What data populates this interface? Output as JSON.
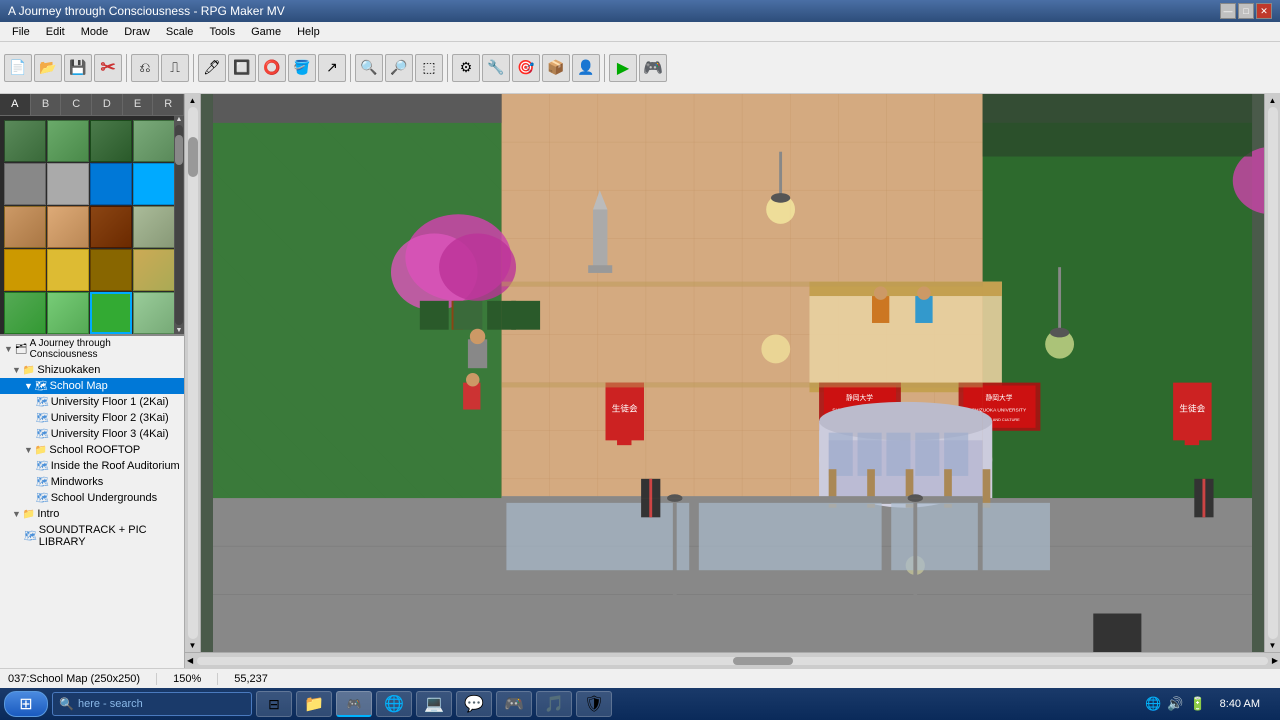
{
  "titlebar": {
    "title": "A Journey through Consciousness - RPG Maker MV",
    "controls": [
      "—",
      "□",
      "✕"
    ]
  },
  "menubar": {
    "items": [
      "File",
      "Edit",
      "Mode",
      "Draw",
      "Scale",
      "Tools",
      "Game",
      "Help"
    ]
  },
  "toolbar": {
    "groups": [
      [
        "💾",
        "📂",
        "🖫",
        "⎌",
        "⎍"
      ],
      [
        "🗂",
        "📋",
        "✂"
      ],
      [
        "🔲",
        "⭕",
        "🖊",
        "↗"
      ],
      [
        "🔍",
        "🔎",
        "🔲",
        "⚙",
        "🔧"
      ],
      [
        "⚙",
        "👤",
        "🔧",
        "🎯",
        "🔄"
      ],
      [
        "▶",
        "🎮"
      ]
    ]
  },
  "tileset": {
    "tabs": [
      "A",
      "B",
      "C",
      "D",
      "E",
      "R"
    ],
    "active_tab": "A",
    "colors": [
      "#4a8a4a",
      "#2a6a2a",
      "#6a9a6a",
      "#3a7a3a",
      "#5a5a5a",
      "#7a7a7a",
      "#9a9a9a",
      "#aaaaaa",
      "#8b7355",
      "#6b5335",
      "#4b3315",
      "#aa8855",
      "#cc9900",
      "#aa7700",
      "#886600",
      "#ddaa44",
      "#cc44aa",
      "#aa2288",
      "#882266",
      "#ee66cc",
      "#4466cc",
      "#2244aa",
      "#113388",
      "#6688ee",
      "#cc3333",
      "#aa1111",
      "#881111",
      "#ee5555",
      "#33cc33",
      "#11aa11",
      "#118811",
      "#55ee55",
      "#ccaa44",
      "#aa8822",
      "#886600",
      "#eebb66",
      "#557755",
      "#336633",
      "#224422",
      "#779977"
    ]
  },
  "maptree": {
    "tabs": [
      "A",
      "B",
      "C",
      "D",
      "E",
      "R"
    ],
    "project": "A Journey through Consciousness",
    "items": [
      {
        "label": "A Journey through Consciousness",
        "level": 0,
        "type": "project",
        "expanded": true
      },
      {
        "label": "Shizuokaken",
        "level": 1,
        "type": "folder",
        "expanded": true
      },
      {
        "label": "School Map",
        "level": 2,
        "type": "map",
        "expanded": true,
        "selected": true
      },
      {
        "label": "University Floor 1 (2Kai)",
        "level": 3,
        "type": "map"
      },
      {
        "label": "University Floor 2 (3Kai)",
        "level": 3,
        "type": "map"
      },
      {
        "label": "University Floor 3 (4Kai)",
        "level": 3,
        "type": "map"
      },
      {
        "label": "School ROOFTOP",
        "level": 2,
        "type": "folder",
        "expanded": true
      },
      {
        "label": "Inside the Roof Auditorium",
        "level": 3,
        "type": "map"
      },
      {
        "label": "Mindworks",
        "level": 3,
        "type": "map"
      },
      {
        "label": "School Undergrounds",
        "level": 3,
        "type": "map"
      },
      {
        "label": "Intro",
        "level": 1,
        "type": "folder",
        "expanded": true
      },
      {
        "label": "SOUNDTRACK + PIC LIBRARY",
        "level": 2,
        "type": "map"
      }
    ]
  },
  "statusbar": {
    "map_info": "037:School Map (250x250)",
    "zoom": "150%",
    "coords": "55,237"
  },
  "taskbar": {
    "time": "8:40 AM",
    "date": "",
    "search_placeholder": "here - search",
    "apps": [
      "⊞",
      "🔍",
      "🗂",
      "📁",
      "🌐",
      "🎮",
      "💬",
      "🎵",
      "🖼",
      "🛡"
    ]
  }
}
